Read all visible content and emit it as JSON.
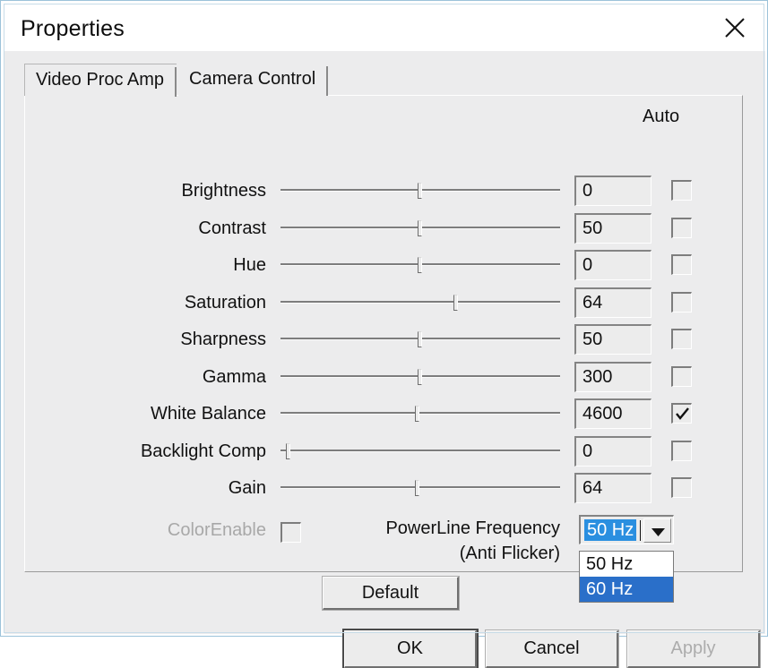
{
  "window": {
    "title": "Properties",
    "close_icon": "close-icon"
  },
  "tabs": [
    {
      "label": "Video Proc Amp",
      "active": true
    },
    {
      "label": "Camera Control",
      "active": false
    }
  ],
  "panel": {
    "auto_column_header": "Auto",
    "controls": [
      {
        "label": "Brightness",
        "value": "0",
        "auto": false,
        "slider_percent": 49
      },
      {
        "label": "Contrast",
        "value": "50",
        "auto": false,
        "slider_percent": 49
      },
      {
        "label": "Hue",
        "value": "0",
        "auto": false,
        "slider_percent": 49
      },
      {
        "label": "Saturation",
        "value": "64",
        "auto": false,
        "slider_percent": 62
      },
      {
        "label": "Sharpness",
        "value": "50",
        "auto": false,
        "slider_percent": 49
      },
      {
        "label": "Gamma",
        "value": "300",
        "auto": false,
        "slider_percent": 49
      },
      {
        "label": "White Balance",
        "value": "4600",
        "auto": true,
        "slider_percent": 48
      },
      {
        "label": "Backlight Comp",
        "value": "0",
        "auto": false,
        "slider_percent": 2
      },
      {
        "label": "Gain",
        "value": "64",
        "auto": false,
        "slider_percent": 48
      }
    ],
    "color_enable": {
      "label": "ColorEnable",
      "checked": false,
      "disabled": true
    },
    "powerline": {
      "label_line1": "PowerLine Frequency",
      "label_line2": "(Anti Flicker)",
      "selected_value": "50 Hz",
      "dropdown_open": true,
      "options": [
        {
          "label": "50 Hz",
          "highlighted": false
        },
        {
          "label": "60 Hz",
          "highlighted": true
        }
      ],
      "arrow_icon": "chevron-down-icon"
    },
    "default_button": "Default"
  },
  "footer": {
    "ok": "OK",
    "cancel": "Cancel",
    "apply": "Apply"
  },
  "colors": {
    "dialog_face": "#ececed",
    "window_border": "#9cc3da",
    "selection_blue": "#2a6fc9",
    "combo_highlight": "#2a8fe0",
    "disabled_text": "#a8a8a8"
  }
}
